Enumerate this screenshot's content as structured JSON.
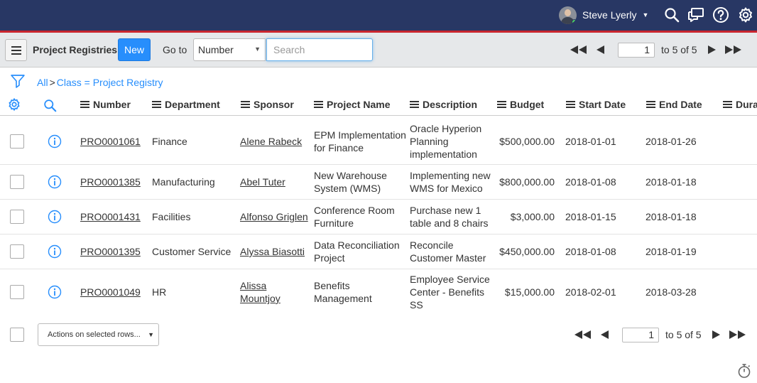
{
  "header": {
    "user_name": "Steve Lyerly",
    "icons": [
      "search-icon",
      "chat-icon",
      "help-icon",
      "gear-icon"
    ],
    "brand_color": "#283764",
    "accent_color": "#c9262f"
  },
  "listbar": {
    "title": "Project Registries",
    "new_label": "New",
    "goto_label": "Go to",
    "goto_field": "Number",
    "search_placeholder": "Search",
    "page_value": "1",
    "page_label": "to 5 of 5"
  },
  "breadcrumb": {
    "root": "All",
    "separator": ">",
    "filter": "Class = Project Registry"
  },
  "table": {
    "columns": [
      "Number",
      "Department",
      "Sponsor",
      "Project Name",
      "Description",
      "Budget",
      "Start Date",
      "End Date",
      "Dura"
    ],
    "rows": [
      {
        "number": "PRO0001061",
        "department": "Finance",
        "sponsor": [
          "Alene Rabeck"
        ],
        "project": [
          "EPM Implementation",
          "for Finance"
        ],
        "description": [
          "Oracle Hyperion",
          "Planning",
          "implementation"
        ],
        "budget": "$500,000.00",
        "start": "2018-01-01",
        "end": "2018-01-26"
      },
      {
        "number": "PRO0001385",
        "department": "Manufacturing",
        "sponsor": [
          "Abel Tuter"
        ],
        "project": [
          "New Warehouse",
          "System (WMS)"
        ],
        "description": [
          "Implementing new",
          "WMS for Mexico"
        ],
        "budget": "$800,000.00",
        "start": "2018-01-08",
        "end": "2018-01-18"
      },
      {
        "number": "PRO0001431",
        "department": "Facilities",
        "sponsor": [
          "Alfonso Griglen"
        ],
        "project": [
          "Conference Room",
          "Furniture"
        ],
        "description": [
          "Purchase new 1",
          "table and 8 chairs"
        ],
        "budget": "$3,000.00",
        "start": "2018-01-15",
        "end": "2018-01-18"
      },
      {
        "number": "PRO0001395",
        "department": "Customer Service",
        "sponsor": [
          "Alyssa Biasotti"
        ],
        "project": [
          "Data Reconciliation",
          "Project"
        ],
        "description": [
          "Reconcile",
          "Customer Master"
        ],
        "budget": "$450,000.00",
        "start": "2018-01-08",
        "end": "2018-01-19"
      },
      {
        "number": "PRO0001049",
        "department": "HR",
        "sponsor": [
          "Alissa",
          "Mountjoy"
        ],
        "project": [
          "Benefits",
          "Management"
        ],
        "description": [
          "Employee Service",
          "Center - Benefits",
          "SS"
        ],
        "budget": "$15,000.00",
        "start": "2018-02-01",
        "end": "2018-03-28"
      }
    ]
  },
  "footer": {
    "actions_label": "Actions on selected rows...",
    "page_value": "1",
    "page_label": "to 5 of 5"
  }
}
